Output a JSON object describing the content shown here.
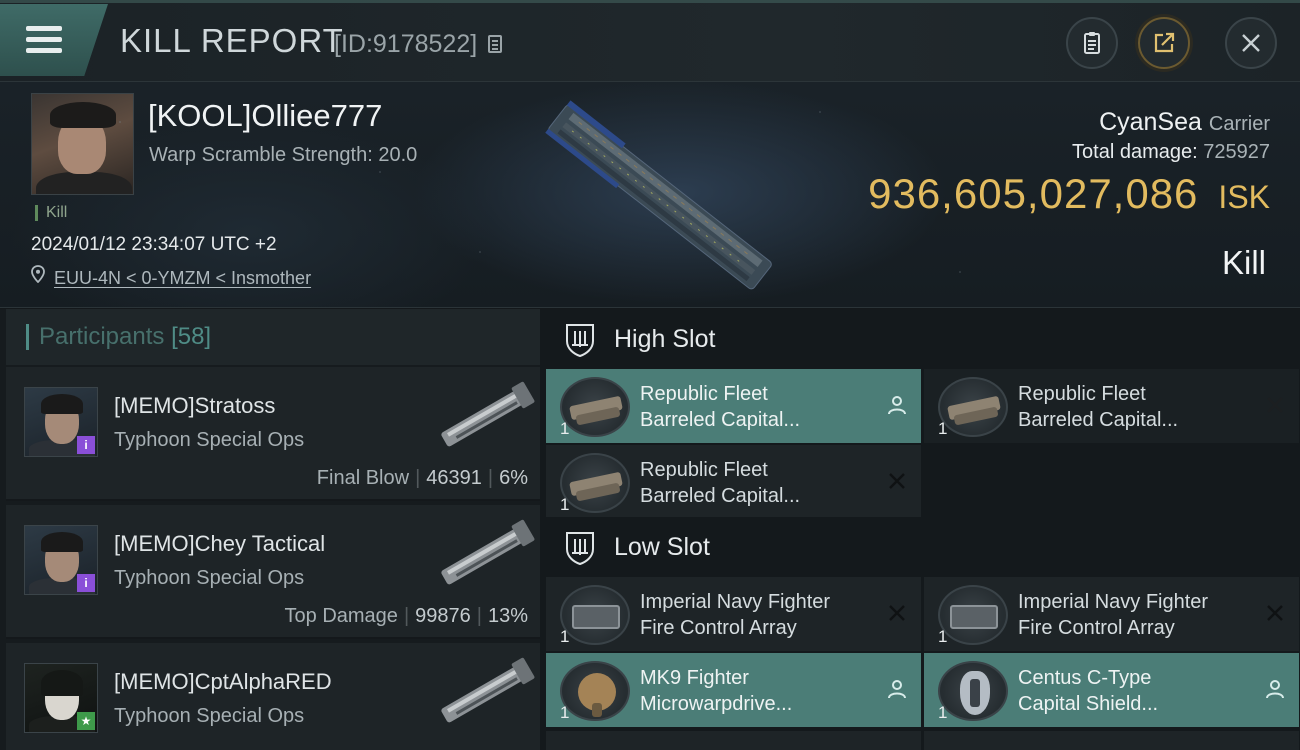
{
  "header": {
    "title": "KILL REPORT",
    "report_id": "[ID:9178522]"
  },
  "victim": {
    "name": "[KOOL]Olliee777",
    "stat_label": "Warp Scramble Strength: 20.0",
    "tag": "Kill",
    "timestamp": "2024/01/12 23:34:07 UTC +2",
    "location": "EUU-4N < 0-YMZM < Insmother",
    "ship_name": "CyanSea",
    "ship_class": "Carrier",
    "total_damage_label": "Total damage:",
    "total_damage": "725927",
    "isk_value": "936,605,027,086",
    "isk_unit": "ISK",
    "result": "Kill"
  },
  "participants": {
    "label": "Participants",
    "count": "[58]",
    "rows": [
      {
        "name": "[MEMO]Stratoss",
        "ship": "Typhoon Special Ops",
        "role": "Final Blow",
        "damage": "46391",
        "percent": "6%",
        "badge": "i"
      },
      {
        "name": "[MEMO]Chey Tactical",
        "ship": "Typhoon Special Ops",
        "role": "Top Damage",
        "damage": "99876",
        "percent": "13%",
        "badge": "i"
      },
      {
        "name": "[MEMO]CptAlphaRED",
        "ship": "Typhoon Special Ops",
        "role": "",
        "damage": "",
        "percent": "",
        "badge": "★"
      }
    ]
  },
  "fitting": {
    "high_slot_label": "High Slot",
    "low_slot_label": "Low Slot",
    "high_slot": [
      {
        "line1": "Republic Fleet",
        "line2": "Barreled Capital...",
        "qty": "1",
        "state": "dropped"
      },
      {
        "line1": "Republic Fleet",
        "line2": "Barreled Capital...",
        "qty": "1",
        "state": "destroyed"
      },
      {
        "line1": "Republic Fleet",
        "line2": "Barreled Capital...",
        "qty": "1",
        "state": "destroyed"
      }
    ],
    "low_slot": [
      {
        "line1": "Imperial Navy Fighter",
        "line2": "Fire Control Array",
        "qty": "1",
        "state": "destroyed"
      },
      {
        "line1": "Imperial Navy Fighter",
        "line2": "Fire Control Array",
        "qty": "1",
        "state": "destroyed"
      },
      {
        "line1": "MK9 Fighter",
        "line2": "Microwarpdrive...",
        "qty": "1",
        "state": "dropped"
      },
      {
        "line1": "Centus C-Type",
        "line2": "Capital Shield...",
        "qty": "1",
        "state": "dropped"
      }
    ]
  },
  "colors": {
    "accent_teal": "#4b7d77",
    "isk_gold": "#e2bb5f",
    "badge_purple": "#8a4fd8",
    "badge_green": "#3e9a4a"
  },
  "icons": [
    "menu-icon",
    "copy-icon",
    "clipboard-icon",
    "share-icon",
    "close-icon",
    "location-pin-icon",
    "slot-shield-icon",
    "person-icon",
    "x-icon"
  ]
}
